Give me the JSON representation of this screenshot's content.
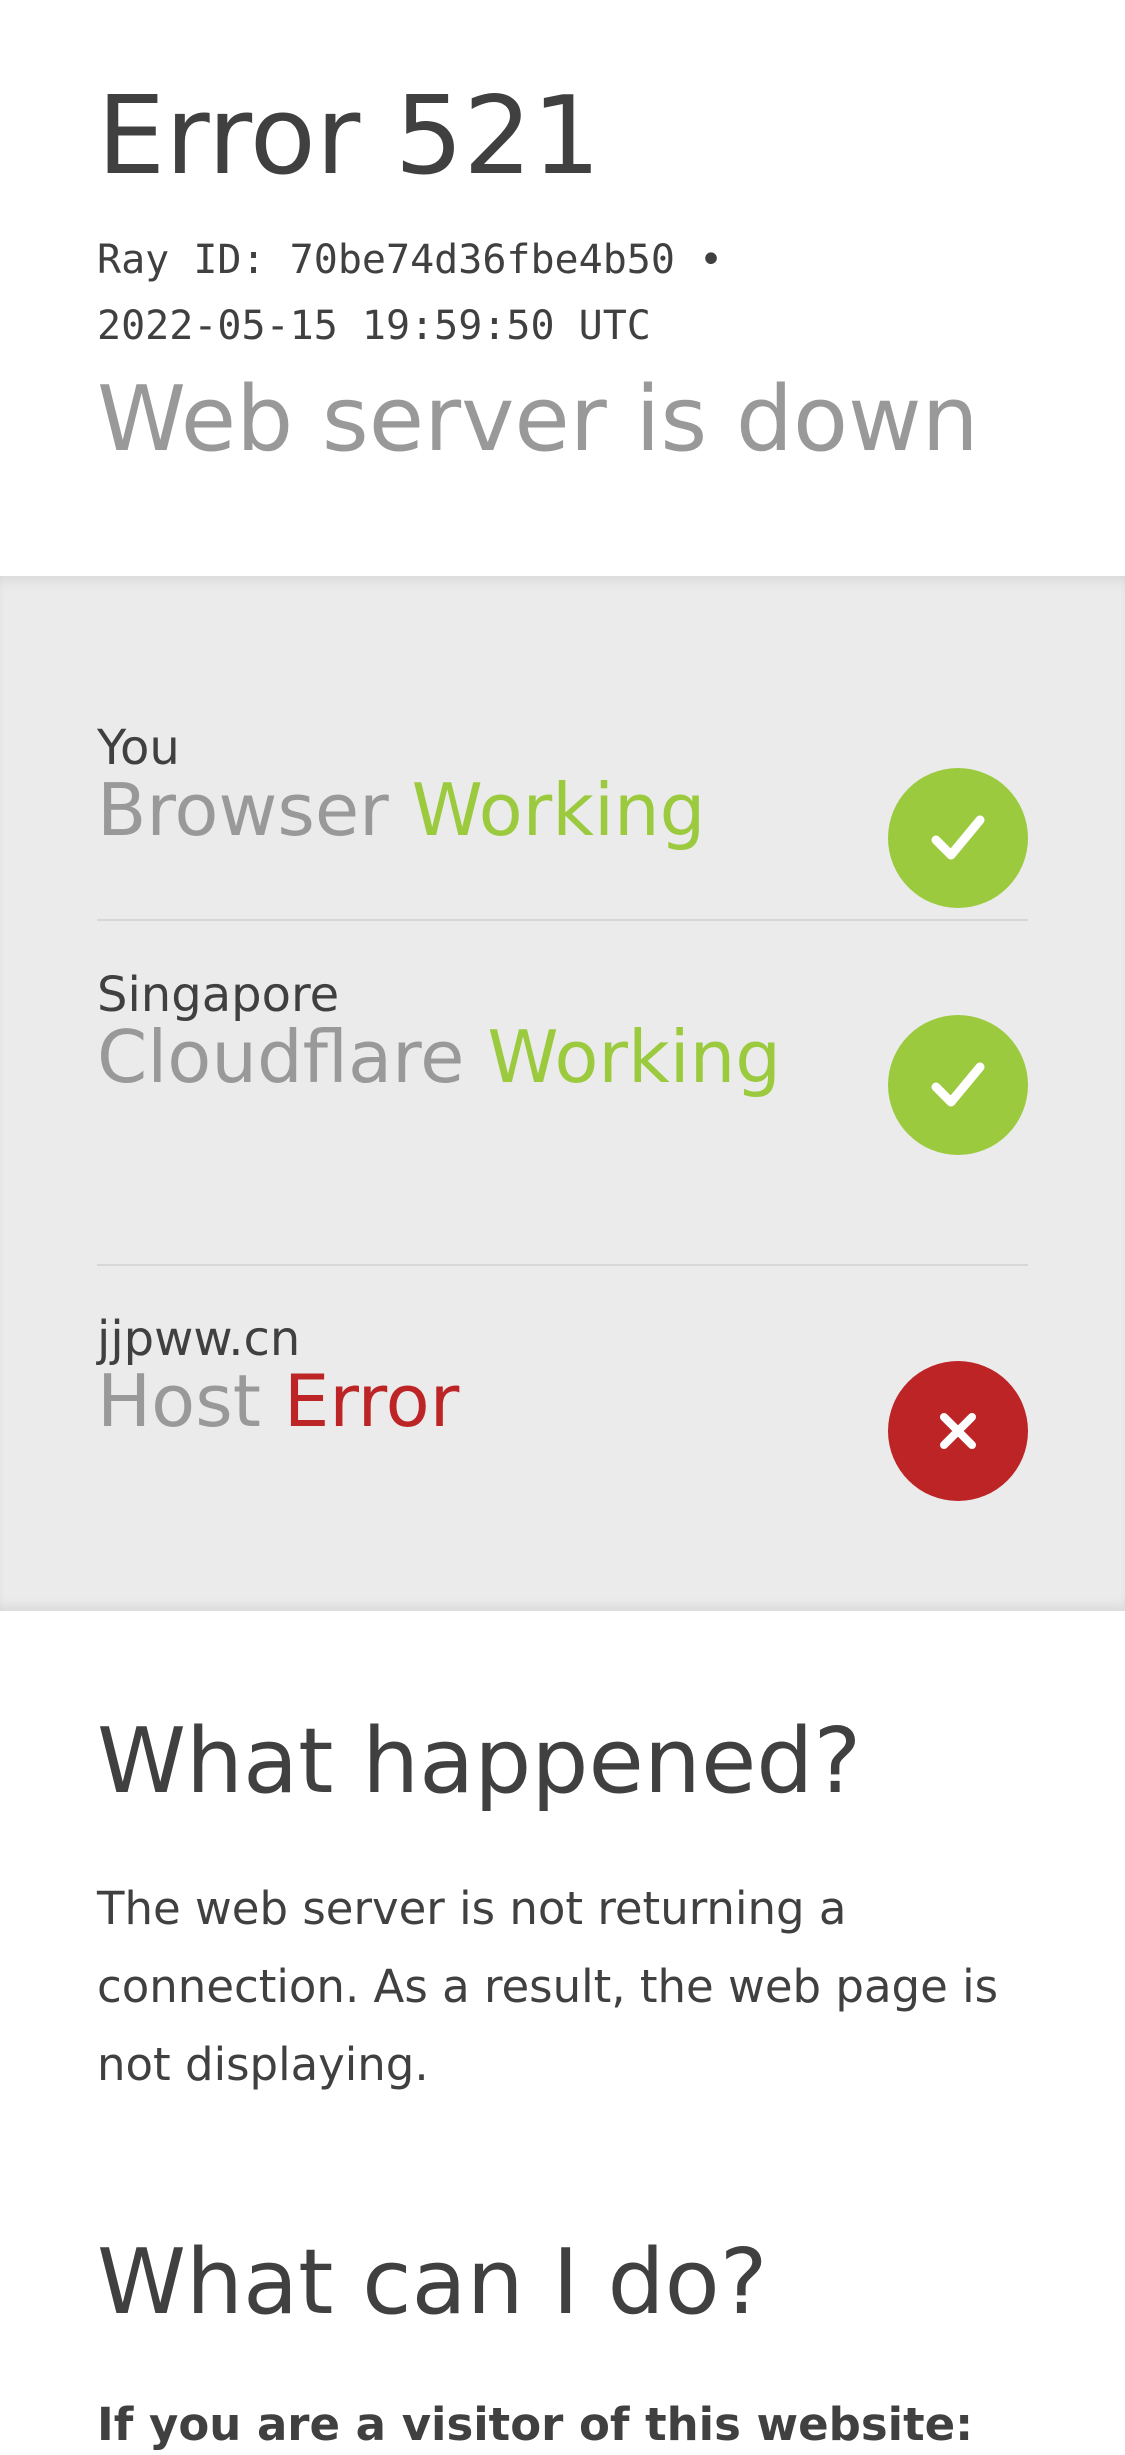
{
  "header": {
    "error_title": "Error 521",
    "ray_line_1": "Ray ID: 70be74d36fbe4b50 •",
    "ray_line_2": "2022-05-15 19:59:50 UTC",
    "subtitle": "Web server is down"
  },
  "status": [
    {
      "location": "You",
      "name": "Browser",
      "state": "Working",
      "icon": "check-icon",
      "color": "#9bca3e"
    },
    {
      "location": "Singapore",
      "name": "Cloudflare",
      "state": "Working",
      "icon": "check-icon",
      "color": "#9bca3e"
    },
    {
      "location": "jjpww.cn",
      "name": "Host",
      "state": "Error",
      "icon": "cross-icon",
      "color": "#bd2426"
    }
  ],
  "what_happened": {
    "title": "What happened?",
    "text": "The web server is not returning a connection. As a result, the web page is not displaying."
  },
  "what_can_i_do": {
    "title": "What can I do?",
    "visitor_heading": "If you are a visitor of this website:"
  }
}
